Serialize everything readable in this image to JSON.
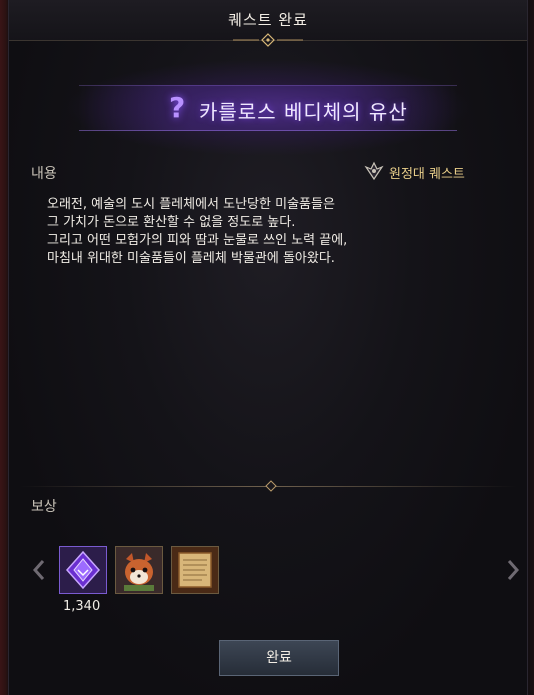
{
  "window": {
    "title": "퀘스트 완료"
  },
  "quest": {
    "mark": "?",
    "title": "카를로스 베디체의 유산",
    "type_label": "원정대 퀘스트",
    "type_icon": "expedition-emblem-icon"
  },
  "content": {
    "label": "내용",
    "lines": [
      "오래전, 예술의 도시 플레체에서 도난당한 미술품들은",
      "그 가치가 돈으로 환산할 수 없을 정도로 높다.",
      "그리고 어떤 모험가의 피와 땀과 눈물로 쓰인 노력 끝에,",
      "마침내 위대한 미술품들이 플레체 박물관에 돌아왔다."
    ]
  },
  "rewards": {
    "label": "보상",
    "items": [
      {
        "icon": "purple-gem-icon",
        "count": "1,340"
      },
      {
        "icon": "red-panda-pet-icon",
        "count": ""
      },
      {
        "icon": "scroll-map-icon",
        "count": ""
      }
    ]
  },
  "actions": {
    "complete_label": "완료"
  },
  "colors": {
    "accent_purple": "#8a55ff",
    "gold_text": "#e9cf8a",
    "button_bg": "#313946"
  }
}
